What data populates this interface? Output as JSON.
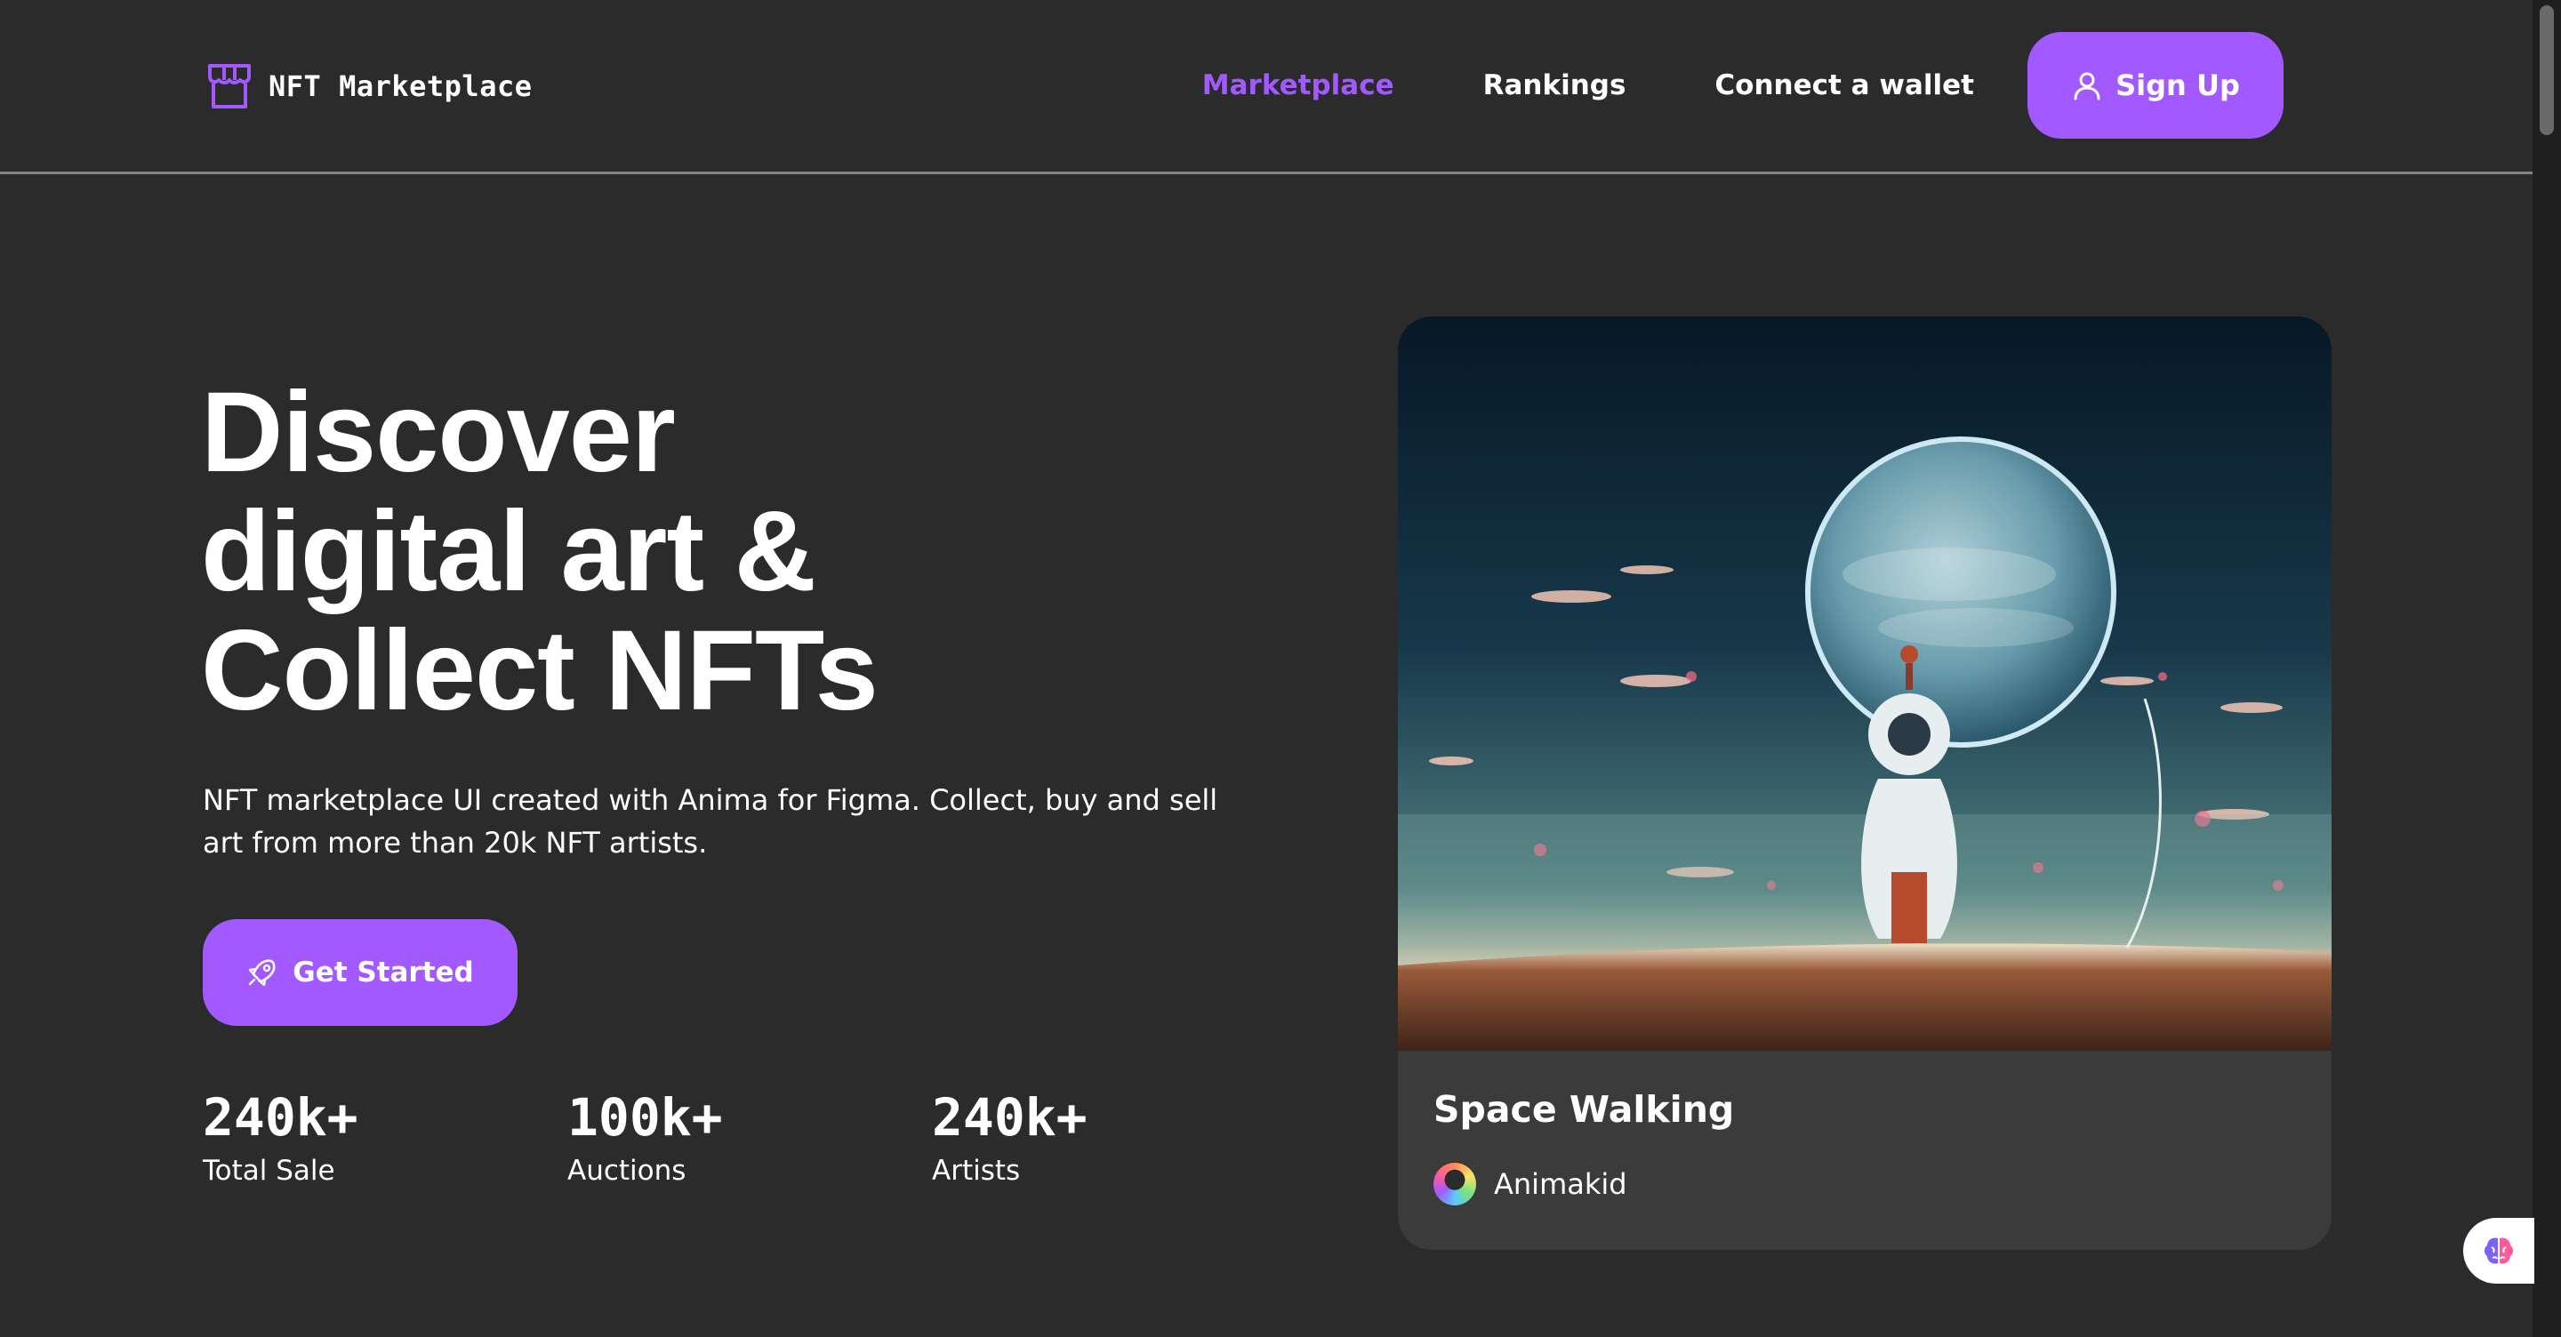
{
  "brand": {
    "name": "NFT Marketplace",
    "icon": "storefront-icon"
  },
  "nav": {
    "links": [
      {
        "label": "Marketplace",
        "active": true
      },
      {
        "label": "Rankings",
        "active": false
      },
      {
        "label": "Connect a wallet",
        "active": false
      }
    ],
    "signup_label": "Sign Up",
    "signup_icon": "user-icon"
  },
  "hero": {
    "headline_lines": [
      "Discover",
      "digital art &",
      "Collect NFTs"
    ],
    "description": "NFT marketplace UI created with Anima for Figma. Collect, buy and sell art from more than 20k NFT artists.",
    "cta_label": "Get Started",
    "cta_icon": "rocket-icon",
    "stats": [
      {
        "value": "240k+",
        "label": "Total Sale"
      },
      {
        "value": "100k+",
        "label": "Auctions"
      },
      {
        "value": "240k+",
        "label": "Artists"
      }
    ]
  },
  "featured": {
    "title": "Space Walking",
    "artist": "Animakid"
  },
  "widget": {
    "icon": "brain-icon"
  },
  "colors": {
    "background": "#2b2b2b",
    "accent": "#a259ff",
    "card": "#3b3b3b",
    "divider": "#858584"
  }
}
